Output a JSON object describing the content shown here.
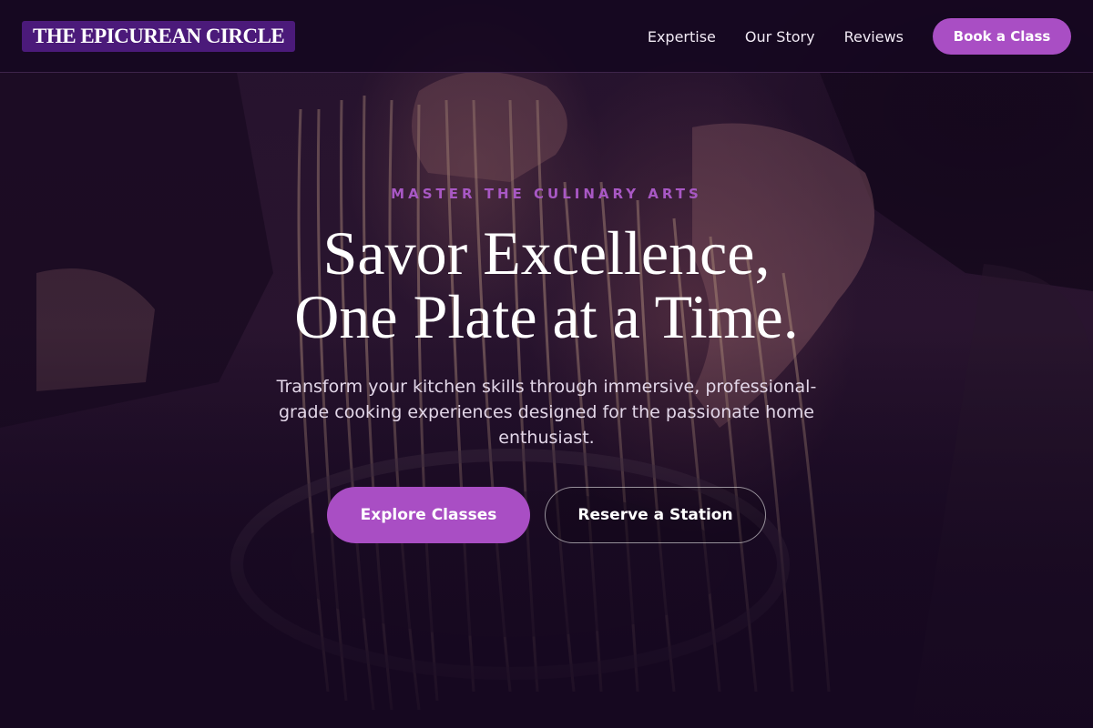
{
  "header": {
    "brand": "THE EPICUREAN CIRCLE",
    "nav": [
      {
        "label": "Expertise"
      },
      {
        "label": "Our Story"
      },
      {
        "label": "Reviews"
      }
    ],
    "cta": "Book a Class"
  },
  "hero": {
    "eyebrow": "MASTER THE CULINARY ARTS",
    "headline_line1": "Savor Excellence,",
    "headline_line2": "One Plate at a Time.",
    "subtext": "Transform your kitchen skills through immersive, professional-grade cooking experiences designed for the passionate home enthusiast.",
    "primary_button": "Explore Classes",
    "secondary_button": "Reserve a Station",
    "background_image": "chef-holding-fresh-pasta-photo"
  },
  "colors": {
    "accent": "#a94ec4",
    "brand_bg": "#4b1a7a",
    "header_bg": "#14061e",
    "hero_dark": "#1c0c24",
    "text_light": "#ffffff"
  }
}
